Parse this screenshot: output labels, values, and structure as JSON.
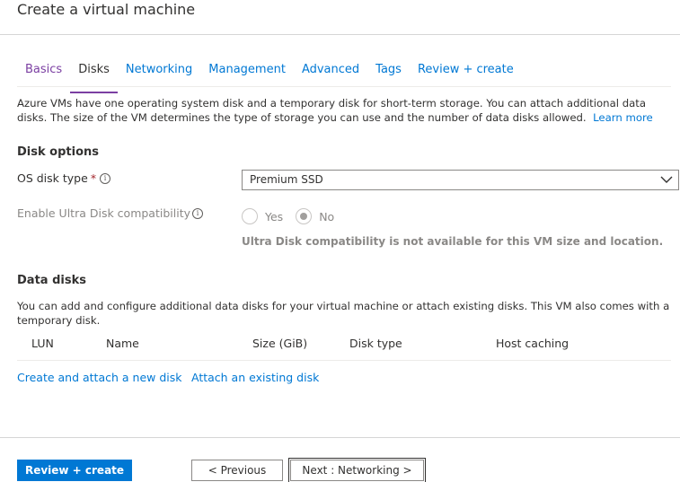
{
  "page": {
    "title": "Create a virtual machine"
  },
  "tabs": [
    {
      "label": "Basics",
      "state": "visited"
    },
    {
      "label": "Disks",
      "state": "active"
    },
    {
      "label": "Networking",
      "state": "default"
    },
    {
      "label": "Management",
      "state": "default"
    },
    {
      "label": "Advanced",
      "state": "default"
    },
    {
      "label": "Tags",
      "state": "default"
    },
    {
      "label": "Review + create",
      "state": "default"
    }
  ],
  "intro": {
    "text": "Azure VMs have one operating system disk and a temporary disk for short-term storage. You can attach additional data disks. The size of the VM determines the type of storage you can use and the number of data disks allowed.",
    "learn_more": "Learn more"
  },
  "disk_options": {
    "title": "Disk options",
    "os_disk_type_label": "OS disk type",
    "required_marker": "*",
    "os_disk_type_value": "Premium SSD",
    "ultra_label": "Enable Ultra Disk compatibility",
    "ultra_options": [
      "Yes",
      "No"
    ],
    "ultra_selected": "No",
    "ultra_note": "Ultra Disk compatibility is not available for this VM size and location."
  },
  "data_disks": {
    "title": "Data disks",
    "description": "You can add and configure additional data disks for your virtual machine or attach existing disks. This VM also comes with a temporary disk.",
    "columns": [
      "LUN",
      "Name",
      "Size (GiB)",
      "Disk type",
      "Host caching"
    ],
    "create_link": "Create and attach a new disk",
    "attach_link": "Attach an existing disk"
  },
  "footer": {
    "review_create": "Review + create",
    "previous": "< Previous",
    "next": "Next : Networking >"
  },
  "colors": {
    "accent": "#0078d4",
    "tab_active_underline": "#7b3fa2",
    "required": "#a4262c"
  },
  "icons": {
    "info": "info-circle-icon",
    "dropdown": "chevron-down-icon"
  }
}
